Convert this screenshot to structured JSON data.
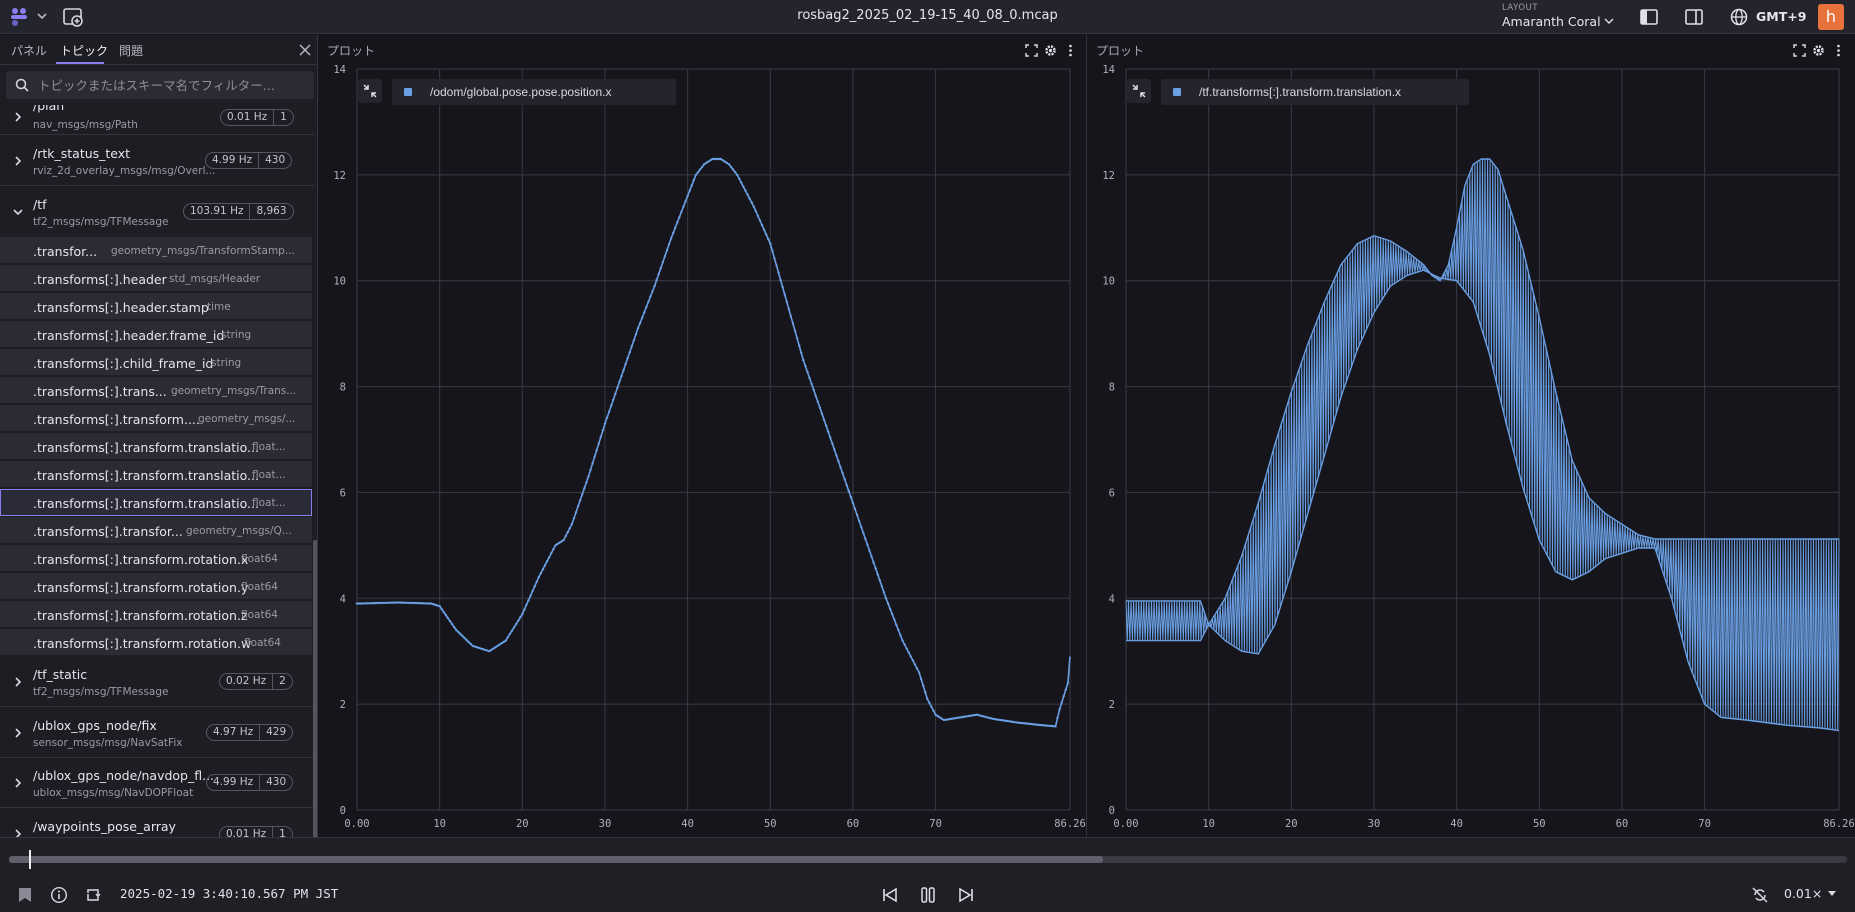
{
  "app": {
    "file_title": "rosbag2_2025_02_19-15_40_08_0.mcap",
    "layout_caption": "LAYOUT",
    "layout_name": "Amaranth Coral",
    "timezone": "GMT+9",
    "avatar_letter": "h",
    "accent_color": "#8a7ff0",
    "avatar_color": "#e8733a"
  },
  "sidebar": {
    "tabs": [
      "パネル",
      "トピック",
      "問題"
    ],
    "active_tab": "トピック",
    "filter_placeholder": "トピックまたはスキーマ名でフィルター...",
    "topics_before": [
      {
        "name": "/plan",
        "type": "nav_msgs/msg/Path",
        "hz": "0.01 Hz",
        "count": "1"
      },
      {
        "name": "/rtk_status_text",
        "type": "rviz_2d_overlay_msgs/msg/Overl...",
        "hz": "4.99 Hz",
        "count": "430"
      },
      {
        "name": "/tf",
        "type": "tf2_msgs/msg/TFMessage",
        "hz": "103.91 Hz",
        "count": "8,963"
      }
    ],
    "fields": [
      {
        "name": ".transfor...",
        "type": "geometry_msgs/TransformStamp..."
      },
      {
        "name": ".transforms[:].header",
        "type": "std_msgs/Header"
      },
      {
        "name": ".transforms[:].header.stamp",
        "type": "time"
      },
      {
        "name": ".transforms[:].header.frame_id",
        "type": "string"
      },
      {
        "name": ".transforms[:].child_frame_id",
        "type": "string"
      },
      {
        "name": ".transforms[:].trans...",
        "type": "geometry_msgs/Trans..."
      },
      {
        "name": ".transforms[:].transform....",
        "type": "geometry_msgs/..."
      },
      {
        "name": ".transforms[:].transform.translatio...",
        "type": "float..."
      },
      {
        "name": ".transforms[:].transform.translatio...",
        "type": "float..."
      },
      {
        "name": ".transforms[:].transform.translatio...",
        "type": "float..."
      },
      {
        "name": ".transforms[:].transfor...",
        "type": "geometry_msgs/Q..."
      },
      {
        "name": ".transforms[:].transform.rotation.x",
        "type": "float64"
      },
      {
        "name": ".transforms[:].transform.rotation.y",
        "type": "float64"
      },
      {
        "name": ".transforms[:].transform.rotation.z",
        "type": "float64"
      },
      {
        "name": ".transforms[:].transform.rotation.w",
        "type": "float64"
      }
    ],
    "topics_after": [
      {
        "name": "/tf_static",
        "type": "tf2_msgs/msg/TFMessage",
        "hz": "0.02 Hz",
        "count": "2"
      },
      {
        "name": "/ublox_gps_node/fix",
        "type": "sensor_msgs/msg/NavSatFix",
        "hz": "4.97 Hz",
        "count": "429"
      },
      {
        "name": "/ublox_gps_node/navdop_fl...",
        "type": "ublox_msgs/msg/NavDOPFloat",
        "hz": "4.99 Hz",
        "count": "430"
      },
      {
        "name": "/waypoints_pose_array",
        "type": "",
        "hz": "0.01 Hz",
        "count": "1"
      }
    ]
  },
  "panels": [
    {
      "title": "プロット",
      "legend": "/odom/global.pose.pose.position.x"
    },
    {
      "title": "プロット",
      "legend": "/tf.transforms[:].transform.translation.x"
    }
  ],
  "chart_data": [
    {
      "type": "line",
      "series": [
        {
          "name": "/odom/global.pose.pose.position.x",
          "color": "#6a9fe3"
        }
      ],
      "x_ticks": [
        "0.00",
        "10",
        "20",
        "30",
        "40",
        "50",
        "60",
        "70",
        "86.26"
      ],
      "y_ticks": [
        "0",
        "2",
        "4",
        "6",
        "8",
        "10",
        "12",
        "14"
      ],
      "xlim": [
        0,
        86.26
      ],
      "ylim": [
        0,
        14
      ],
      "grid": true,
      "points": [
        [
          0,
          3.9
        ],
        [
          5,
          3.92
        ],
        [
          9,
          3.9
        ],
        [
          10,
          3.85
        ],
        [
          12,
          3.4
        ],
        [
          14,
          3.1
        ],
        [
          16,
          3.0
        ],
        [
          18,
          3.2
        ],
        [
          20,
          3.7
        ],
        [
          22,
          4.4
        ],
        [
          24,
          5.0
        ],
        [
          25,
          5.1
        ],
        [
          26,
          5.4
        ],
        [
          28,
          6.3
        ],
        [
          30,
          7.3
        ],
        [
          32,
          8.2
        ],
        [
          34,
          9.1
        ],
        [
          36,
          9.9
        ],
        [
          38,
          10.8
        ],
        [
          40,
          11.6
        ],
        [
          41,
          12.0
        ],
        [
          42,
          12.2
        ],
        [
          43,
          12.3
        ],
        [
          44,
          12.3
        ],
        [
          45,
          12.2
        ],
        [
          46,
          12.0
        ],
        [
          48,
          11.4
        ],
        [
          50,
          10.7
        ],
        [
          52,
          9.6
        ],
        [
          54,
          8.5
        ],
        [
          56,
          7.6
        ],
        [
          58,
          6.7
        ],
        [
          60,
          5.8
        ],
        [
          62,
          4.9
        ],
        [
          64,
          4.0
        ],
        [
          66,
          3.2
        ],
        [
          68,
          2.6
        ],
        [
          69,
          2.1
        ],
        [
          70,
          1.8
        ],
        [
          71,
          1.7
        ],
        [
          73,
          1.75
        ],
        [
          75,
          1.8
        ],
        [
          77,
          1.72
        ],
        [
          80,
          1.65
        ],
        [
          83,
          1.6
        ],
        [
          84.5,
          1.58
        ],
        [
          85,
          1.9
        ],
        [
          86,
          2.4
        ],
        [
          86.26,
          2.9
        ]
      ]
    },
    {
      "type": "area",
      "series": [
        {
          "name": "/tf.transforms[:].transform.translation.x",
          "color": "#6a9fe3"
        }
      ],
      "x_ticks": [
        "0.00",
        "10",
        "20",
        "30",
        "40",
        "50",
        "60",
        "70",
        "86.26"
      ],
      "y_ticks": [
        "0",
        "2",
        "4",
        "6",
        "8",
        "10",
        "12",
        "14"
      ],
      "xlim": [
        0,
        86.26
      ],
      "ylim": [
        0,
        14
      ],
      "grid": true,
      "upper": [
        [
          0,
          3.95
        ],
        [
          5,
          3.95
        ],
        [
          9,
          3.95
        ],
        [
          10,
          3.5
        ],
        [
          12,
          4.0
        ],
        [
          14,
          4.8
        ],
        [
          16,
          5.8
        ],
        [
          18,
          6.9
        ],
        [
          20,
          7.9
        ],
        [
          22,
          8.8
        ],
        [
          24,
          9.6
        ],
        [
          26,
          10.3
        ],
        [
          28,
          10.7
        ],
        [
          30,
          10.85
        ],
        [
          32,
          10.75
        ],
        [
          34,
          10.55
        ],
        [
          36,
          10.3
        ],
        [
          37,
          10.1
        ],
        [
          38,
          10.0
        ],
        [
          39,
          10.3
        ],
        [
          40,
          11.0
        ],
        [
          41,
          11.8
        ],
        [
          42,
          12.2
        ],
        [
          43,
          12.3
        ],
        [
          44,
          12.3
        ],
        [
          45,
          12.1
        ],
        [
          46,
          11.6
        ],
        [
          48,
          10.6
        ],
        [
          50,
          9.3
        ],
        [
          52,
          7.9
        ],
        [
          54,
          6.6
        ],
        [
          56,
          5.9
        ],
        [
          58,
          5.6
        ],
        [
          60,
          5.4
        ],
        [
          62,
          5.2
        ],
        [
          64,
          5.12
        ],
        [
          66,
          5.12
        ],
        [
          70,
          5.12
        ],
        [
          75,
          5.12
        ],
        [
          80,
          5.12
        ],
        [
          86.26,
          5.12
        ]
      ],
      "lower": [
        [
          0,
          3.2
        ],
        [
          5,
          3.2
        ],
        [
          9,
          3.2
        ],
        [
          10,
          3.5
        ],
        [
          12,
          3.2
        ],
        [
          14,
          3.0
        ],
        [
          16,
          2.95
        ],
        [
          18,
          3.5
        ],
        [
          20,
          4.5
        ],
        [
          22,
          5.6
        ],
        [
          24,
          6.7
        ],
        [
          26,
          7.8
        ],
        [
          28,
          8.7
        ],
        [
          30,
          9.4
        ],
        [
          32,
          9.9
        ],
        [
          34,
          10.1
        ],
        [
          36,
          10.2
        ],
        [
          38,
          10.05
        ],
        [
          40,
          10.0
        ],
        [
          42,
          9.6
        ],
        [
          44,
          8.6
        ],
        [
          46,
          7.3
        ],
        [
          48,
          6.1
        ],
        [
          50,
          5.1
        ],
        [
          52,
          4.5
        ],
        [
          54,
          4.35
        ],
        [
          56,
          4.5
        ],
        [
          58,
          4.75
        ],
        [
          60,
          4.85
        ],
        [
          62,
          4.95
        ],
        [
          64,
          4.95
        ],
        [
          66,
          4.0
        ],
        [
          68,
          2.8
        ],
        [
          70,
          2.0
        ],
        [
          72,
          1.75
        ],
        [
          75,
          1.7
        ],
        [
          80,
          1.6
        ],
        [
          84,
          1.55
        ],
        [
          86.26,
          1.5
        ]
      ]
    }
  ],
  "playback": {
    "timestamp": "2025-02-19 3:40:10.567 PM JST",
    "speed": "0.01×",
    "progress_played": 0.011,
    "progress_loaded": 0.595
  }
}
